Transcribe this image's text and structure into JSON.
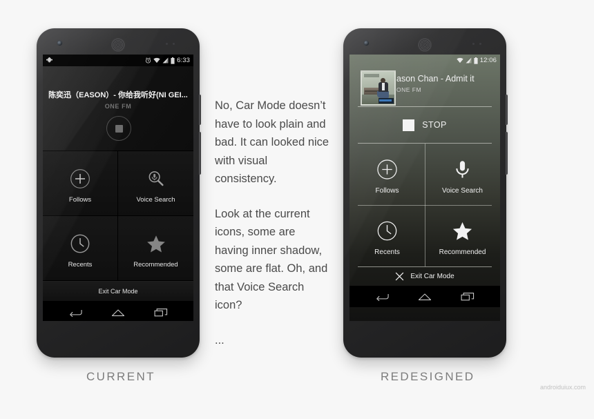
{
  "captions": {
    "left": "CURRENT",
    "right": "REDESIGNED"
  },
  "watermark": "androiduiux.com",
  "narrative": {
    "paragraph_1": "No, Car Mode doesn’t have to look plain and bad. It can looked nice with visual consistency.",
    "paragraph_2": "Look at the current icons, some are having inner shadow, some are flat. Oh, and that Voice Search icon?",
    "paragraph_3": "..."
  },
  "current_phone": {
    "statusbar": {
      "notification_icon": "plus-notification-icon",
      "alarm_icon": "alarm-clock-icon",
      "wifi_icon": "wifi-icon",
      "signal_icon": "signal-bars-icon",
      "battery_icon": "battery-icon",
      "time": "6:33"
    },
    "now_playing": {
      "title": "陈奕迅（EASON）- 你给我听好(NI GEI...",
      "station": "ONE FM",
      "stop_icon": "stop-square-icon"
    },
    "grid": [
      {
        "label": "Follows",
        "icon": "plus-circle-icon"
      },
      {
        "label": "Voice Search",
        "icon": "mic-magnifier-icon"
      },
      {
        "label": "Recents",
        "icon": "clock-icon"
      },
      {
        "label": "Recommended",
        "icon": "star-icon"
      }
    ],
    "exit_label": "Exit Car Mode",
    "navbar": [
      {
        "name": "back-nav-icon"
      },
      {
        "name": "home-nav-icon"
      },
      {
        "name": "recents-nav-icon"
      }
    ]
  },
  "redesigned_phone": {
    "statusbar": {
      "wifi_icon": "wifi-icon",
      "signal_icon": "signal-bars-icon",
      "battery_icon": "battery-icon",
      "time": "12:06"
    },
    "now_playing": {
      "title": "ason Chan - Admit it",
      "station": "ONE FM",
      "album_art": "album-art-thumbnail"
    },
    "controls": {
      "stop_label": "STOP",
      "stop_icon": "stop-square-icon"
    },
    "grid": [
      {
        "label": "Follows",
        "icon": "plus-circle-icon"
      },
      {
        "label": "Voice Search",
        "icon": "microphone-icon"
      },
      {
        "label": "Recents",
        "icon": "clock-icon"
      },
      {
        "label": "Recommended",
        "icon": "star-icon"
      }
    ],
    "exit_label": "Exit Car Mode",
    "exit_icon": "close-x-icon",
    "navbar": [
      {
        "name": "back-nav-icon"
      },
      {
        "name": "home-nav-icon"
      },
      {
        "name": "recents-nav-icon"
      }
    ]
  },
  "colors": {
    "background": "#f7f7f7",
    "caption": "#7c7c7c",
    "narrative_text": "#4a4a4a",
    "redesign_top": "#6d7668",
    "redesign_bottom": "#121211"
  }
}
